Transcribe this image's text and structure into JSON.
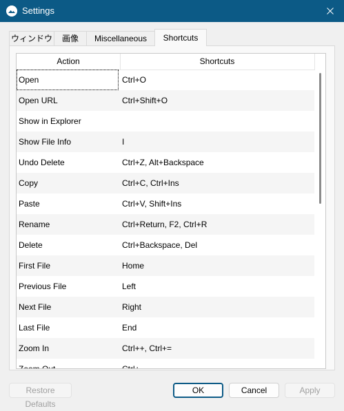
{
  "window": {
    "title": "Settings",
    "close_icon": "close-icon",
    "app_icon": "image-viewer-app-icon"
  },
  "tabs": [
    {
      "label": "ウィンドウ",
      "active": false
    },
    {
      "label": "画像",
      "active": false
    },
    {
      "label": "Miscellaneous",
      "active": false
    },
    {
      "label": "Shortcuts",
      "active": true
    }
  ],
  "table": {
    "columns": [
      "Action",
      "Shortcuts"
    ],
    "rows": [
      {
        "action": "Open",
        "shortcuts": "Ctrl+O"
      },
      {
        "action": "Open URL",
        "shortcuts": "Ctrl+Shift+O"
      },
      {
        "action": "Show in Explorer",
        "shortcuts": ""
      },
      {
        "action": "Show File Info",
        "shortcuts": "I"
      },
      {
        "action": "Undo Delete",
        "shortcuts": "Ctrl+Z, Alt+Backspace"
      },
      {
        "action": "Copy",
        "shortcuts": "Ctrl+C, Ctrl+Ins"
      },
      {
        "action": "Paste",
        "shortcuts": "Ctrl+V, Shift+Ins"
      },
      {
        "action": "Rename",
        "shortcuts": "Ctrl+Return, F2, Ctrl+R"
      },
      {
        "action": "Delete",
        "shortcuts": "Ctrl+Backspace, Del"
      },
      {
        "action": "First File",
        "shortcuts": "Home"
      },
      {
        "action": "Previous File",
        "shortcuts": "Left"
      },
      {
        "action": "Next File",
        "shortcuts": "Right"
      },
      {
        "action": "Last File",
        "shortcuts": "End"
      },
      {
        "action": "Zoom In",
        "shortcuts": "Ctrl++, Ctrl+="
      },
      {
        "action": "Zoom Out",
        "shortcuts": "Ctrl+-"
      }
    ],
    "selected_row": 0
  },
  "buttons": {
    "restore_defaults": "Restore Defaults",
    "ok": "OK",
    "cancel": "Cancel",
    "apply": "Apply"
  },
  "colors": {
    "titlebar": "#0c5a86",
    "row_alt": "#f5f5f5",
    "accent": "#0c5a86"
  }
}
